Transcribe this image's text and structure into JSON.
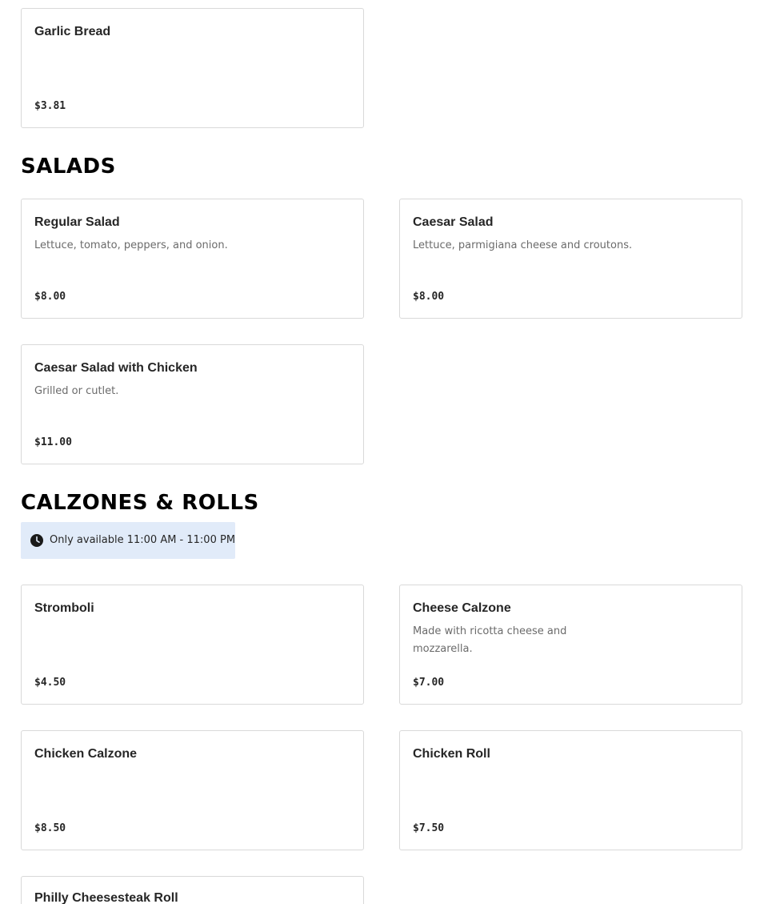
{
  "sections": {
    "salads": {
      "title": "SALADS"
    },
    "calzones": {
      "title": "CALZONES & ROLLS",
      "availability": "Only available 11:00 AM - 11:00 PM",
      "availability_icon": "clock-icon"
    }
  },
  "items": {
    "garlic_bread": {
      "name": "Garlic Bread",
      "price": "$3.81"
    },
    "regular_salad": {
      "name": "Regular Salad",
      "description": "Lettuce, tomato, peppers, and onion.",
      "price": "$8.00"
    },
    "caesar_salad": {
      "name": "Caesar Salad",
      "description": "Lettuce, parmigiana cheese and croutons.",
      "price": "$8.00"
    },
    "caesar_salad_chicken": {
      "name": "Caesar Salad with Chicken",
      "description": "Grilled or cutlet.",
      "price": "$11.00"
    },
    "stromboli": {
      "name": "Stromboli",
      "price": "$4.50"
    },
    "cheese_calzone": {
      "name": "Cheese Calzone",
      "description": "Made with ricotta cheese and mozzarella.",
      "price": "$7.00"
    },
    "chicken_calzone": {
      "name": "Chicken Calzone",
      "price": "$8.50"
    },
    "chicken_roll": {
      "name": "Chicken Roll",
      "price": "$7.50"
    },
    "philly_roll": {
      "name": "Philly Cheesesteak Roll"
    }
  },
  "colors": {
    "availability_bg": "#e1ebf9",
    "card_border": "#d9d9d9",
    "description_text": "#6b6b6b"
  }
}
